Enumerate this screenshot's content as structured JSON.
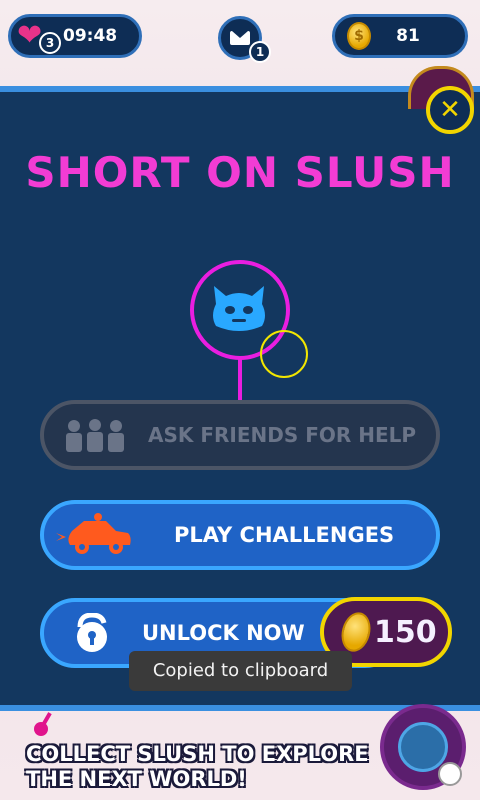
{
  "status_bar": {
    "lives_count": "3",
    "timer": "09:48",
    "mail_count": "1",
    "coins": "81"
  },
  "modal": {
    "title": "SHORT ON SLUSH",
    "ask_friends_label": "ASK FRIENDS FOR HELP",
    "play_challenges_label": "PLAY CHALLENGES",
    "unlock_label": "UNLOCK NOW",
    "unlock_price": "150"
  },
  "toast": "Copied to clipboard",
  "footer": {
    "message": "COLLECT SLUSH TO EXPLORE THE NEXT WORLD!"
  },
  "colors": {
    "title": "#f23cd4",
    "panel": "#13375f",
    "accent_blue": "#3aa7ff",
    "gold": "#f2d500"
  },
  "icons": [
    "heart-icon",
    "mail-icon",
    "coin-icon",
    "close-icon",
    "ghost-icon",
    "friends-icon",
    "car-icon",
    "lock-icon",
    "world-icon"
  ]
}
